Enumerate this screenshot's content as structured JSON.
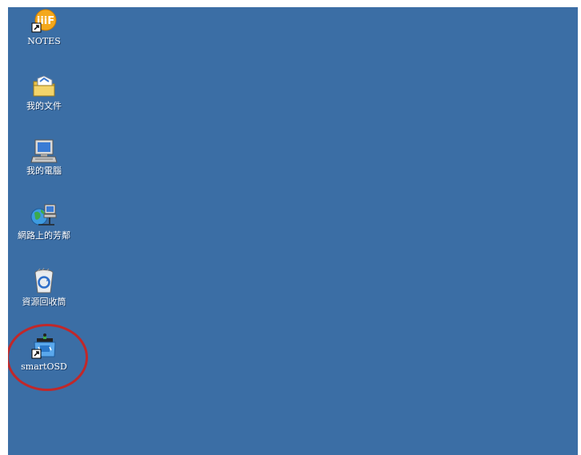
{
  "desktop": {
    "icons": [
      {
        "label": "NOTES",
        "icon": "lotus-notes-icon",
        "shortcut": true
      },
      {
        "label": "我的文件",
        "icon": "my-documents-folder-icon",
        "shortcut": false
      },
      {
        "label": "我的電腦",
        "icon": "my-computer-icon",
        "shortcut": false
      },
      {
        "label": "網路上的芳鄰",
        "icon": "network-neighborhood-icon",
        "shortcut": false
      },
      {
        "label": "資源回收筒",
        "icon": "recycle-bin-icon",
        "shortcut": false
      },
      {
        "label": "smartOSD",
        "icon": "smartosd-icon",
        "shortcut": true
      }
    ],
    "background_color": "#3b6ea5",
    "highlight_color": "#c0282a"
  }
}
